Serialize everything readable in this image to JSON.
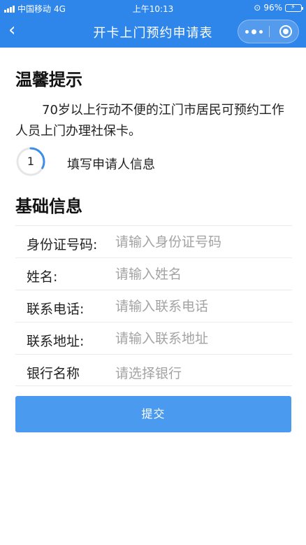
{
  "status_bar": {
    "carrier": "中国移动",
    "network": "4G",
    "time": "上午10:13",
    "battery": "96%",
    "battery_level": 0.96,
    "battery_color": "#4cd964"
  },
  "nav": {
    "title": "开卡上门预约申请表",
    "back_icon": "chevron-left-icon",
    "more_icon": "more-dots-icon",
    "home_icon": "target-circle-icon",
    "bar_color": "#2f86ea"
  },
  "notice": {
    "title": "温馨提示",
    "text": "70岁以上行动不便的江门市居民可预约工作人员上门办理社保卡。"
  },
  "step": {
    "number": "1",
    "label": "填写申请人信息",
    "progress": 0.33
  },
  "form": {
    "title": "基础信息",
    "fields": [
      {
        "label": "身份证号码:",
        "placeholder": "请输入身份证号码"
      },
      {
        "label": "姓名:",
        "placeholder": "请输入姓名"
      },
      {
        "label": "联系电话:",
        "placeholder": "请输入联系电话"
      },
      {
        "label": "联系地址:",
        "placeholder": "请输入联系地址"
      },
      {
        "label": "银行名称",
        "placeholder": "请选择银行"
      }
    ],
    "submit_label": "提交",
    "submit_color": "#4a9af0"
  }
}
